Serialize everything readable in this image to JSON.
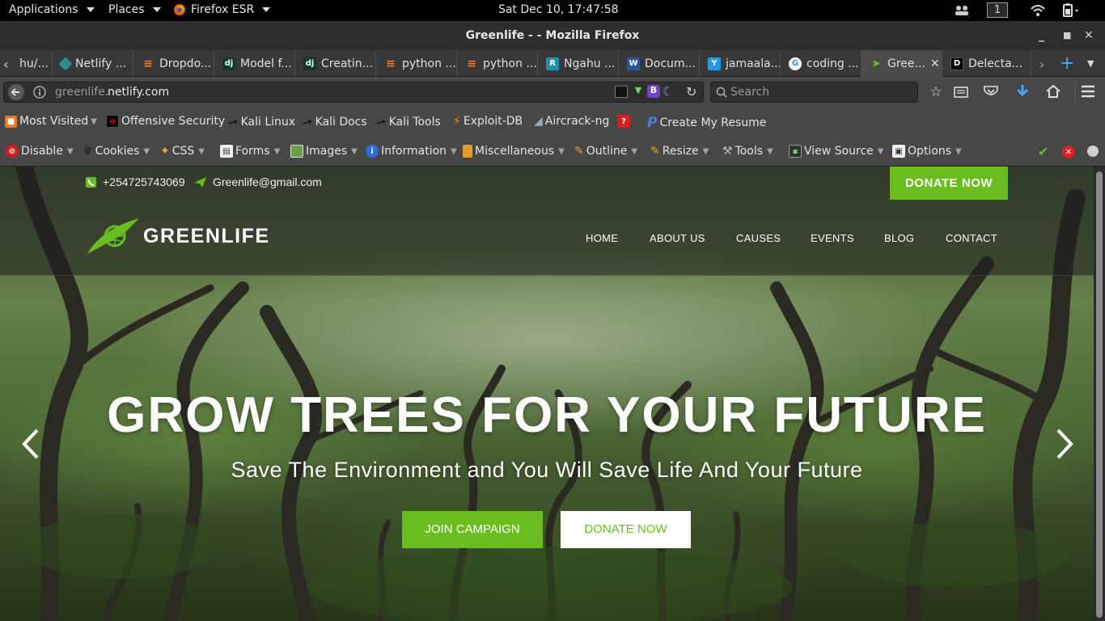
{
  "gnome": {
    "applications": "Applications",
    "places": "Places",
    "app_name": "Firefox ESR",
    "clock": "Sat Dec 10, 17:47:58",
    "workspace": "1"
  },
  "window": {
    "title": "Greenlife - - Mozilla Firefox"
  },
  "tabs": [
    {
      "label": "hu/...",
      "icon": "page-icon"
    },
    {
      "label": "Netlify ...",
      "icon": "netlify-icon"
    },
    {
      "label": "Dropdo...",
      "icon": "stackoverflow-icon"
    },
    {
      "label": "Model f...",
      "icon": "django-icon"
    },
    {
      "label": "Creatin...",
      "icon": "django-icon"
    },
    {
      "label": "python ...",
      "icon": "stackoverflow-icon"
    },
    {
      "label": "python ...",
      "icon": "stackoverflow-icon"
    },
    {
      "label": "Ngahu ...",
      "icon": "r-icon"
    },
    {
      "label": "Docum...",
      "icon": "word-icon"
    },
    {
      "label": "jamaala...",
      "icon": "y-icon"
    },
    {
      "label": "coding ...",
      "icon": "google-icon"
    },
    {
      "label": "Gree...",
      "icon": "greenlife-icon"
    },
    {
      "label": "Delecta...",
      "icon": "d-icon"
    }
  ],
  "navbar": {
    "url_host_prefix": "greenlife.",
    "url_host_domain": "netlify.com",
    "search_placeholder": "Search"
  },
  "bookmarks": [
    "Most Visited",
    "Offensive Security",
    "Kali Linux",
    "Kali Docs",
    "Kali Tools",
    "Exploit-DB",
    "Aircrack-ng",
    "Create My Resume"
  ],
  "devtools": [
    "Disable",
    "Cookies",
    "CSS",
    "Forms",
    "Images",
    "Information",
    "Miscellaneous",
    "Outline",
    "Resize",
    "Tools",
    "View Source",
    "Options"
  ],
  "site": {
    "phone": "+254725743069",
    "email": "Greenlife@gmail.com",
    "donate_top": "DONATE NOW",
    "logo": "GREENLIFE",
    "menu": [
      "HOME",
      "ABOUT US",
      "CAUSES",
      "EVENTS",
      "BLOG",
      "CONTACT"
    ],
    "hero_title": "GROW TREES FOR YOUR FUTURE",
    "hero_subtitle": "Save The Environment and You Will Save Life And Your Future",
    "btn_join": "JOIN CAMPAIGN",
    "btn_donate": "DONATE NOW",
    "accent_color": "#6abd1f"
  }
}
